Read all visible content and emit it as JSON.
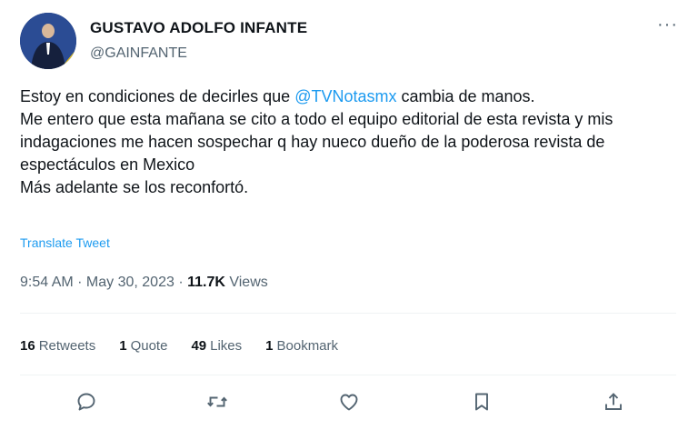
{
  "author": {
    "name": "GUSTAVO ADOLFO INFANTE",
    "handle": "@GAINFANTE"
  },
  "tweet": {
    "text_before": "Estoy en condiciones de decirles que ",
    "mention": "@TVNotasmx",
    "text_after": " cambia de manos.\nMe entero que esta mañana se cito a todo el equipo editorial de esta revista y mis indagaciones me hacen sospechar q hay nueco dueño de la poderosa revista de espectáculos en Mexico\nMás adelante se los reconfortó.",
    "translate_label": "Translate Tweet"
  },
  "meta": {
    "time": "9:54 AM",
    "separator": " · ",
    "date": "May 30, 2023",
    "views_count": "11.7K",
    "views_label": "Views"
  },
  "stats": {
    "retweets_count": "16",
    "retweets_label": "Retweets",
    "quotes_count": "1",
    "quotes_label": "Quote",
    "likes_count": "49",
    "likes_label": "Likes",
    "bookmarks_count": "1",
    "bookmarks_label": "Bookmark"
  },
  "more_glyph": "···",
  "icons": {
    "reply": "reply-icon",
    "retweet": "retweet-icon",
    "like": "heart-icon",
    "bookmark": "bookmark-icon",
    "share": "share-icon"
  },
  "colors": {
    "accent": "#1d9bf0",
    "text": "#0f1419",
    "muted": "#536471",
    "divider": "#eff3f4"
  }
}
